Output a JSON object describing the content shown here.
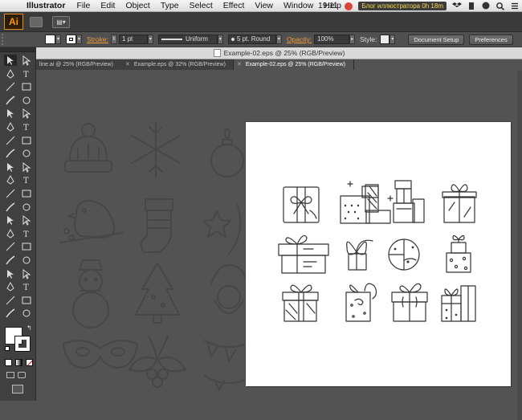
{
  "menubar": {
    "app_name": "Illustrator",
    "items": [
      "File",
      "Edit",
      "Object",
      "Type",
      "Select",
      "Effect",
      "View",
      "Window",
      "Help"
    ],
    "clock": "19:11",
    "badge": "Блог иллюстратора  0h 18m"
  },
  "appbar": {
    "logo": "Ai",
    "arrange_label": "▤▾"
  },
  "control_bar": {
    "stroke_label": "Stroke:",
    "stroke_value": "1 pt",
    "profile": "Uniform",
    "brush": "5 pt. Round",
    "opacity_label": "Opacity:",
    "opacity_value": "100%",
    "style_label": "Style:",
    "document_setup": "Document Setup",
    "preferences": "Preferences"
  },
  "doc_title": "Example-02.eps @ 25% (RGB/Preview)",
  "doc_tabs": [
    {
      "label": "line.ai @ 25% (RGB/Preview)",
      "active": false
    },
    {
      "label": "Example.eps @ 32% (RGB/Preview)",
      "active": false
    },
    {
      "label": "Example-02.eps @ 25% (RGB/Preview)",
      "active": true
    }
  ],
  "colors": {
    "accent": "#f09b38",
    "ui_dark": "#404040",
    "canvas": "#535353",
    "artboard": "#ffffff",
    "icon_stroke": "#333333"
  },
  "artboard_icons": [
    "gift-box-bow-icon",
    "gift-stack-icon",
    "gift-tower-icon",
    "gift-box-ribbon-icon",
    "gift-box-swirl-icon",
    "gift-bow-round-icon",
    "gift-bauble-icon",
    "gift-box-dots-icon",
    "gift-box-stripes-icon",
    "gift-box-spiral-icon",
    "gift-box-wide-icon",
    "gift-pair-icon"
  ],
  "background_icons": [
    "winter-hat-icon",
    "snowflake-icon",
    "ornament-icon",
    "bird-icon",
    "stocking-icon",
    "star-moon-icon",
    "snowman-icon",
    "christmas-tree-icon",
    "santa-icon",
    "mask-icon",
    "holly-icon",
    "garland-icon"
  ]
}
